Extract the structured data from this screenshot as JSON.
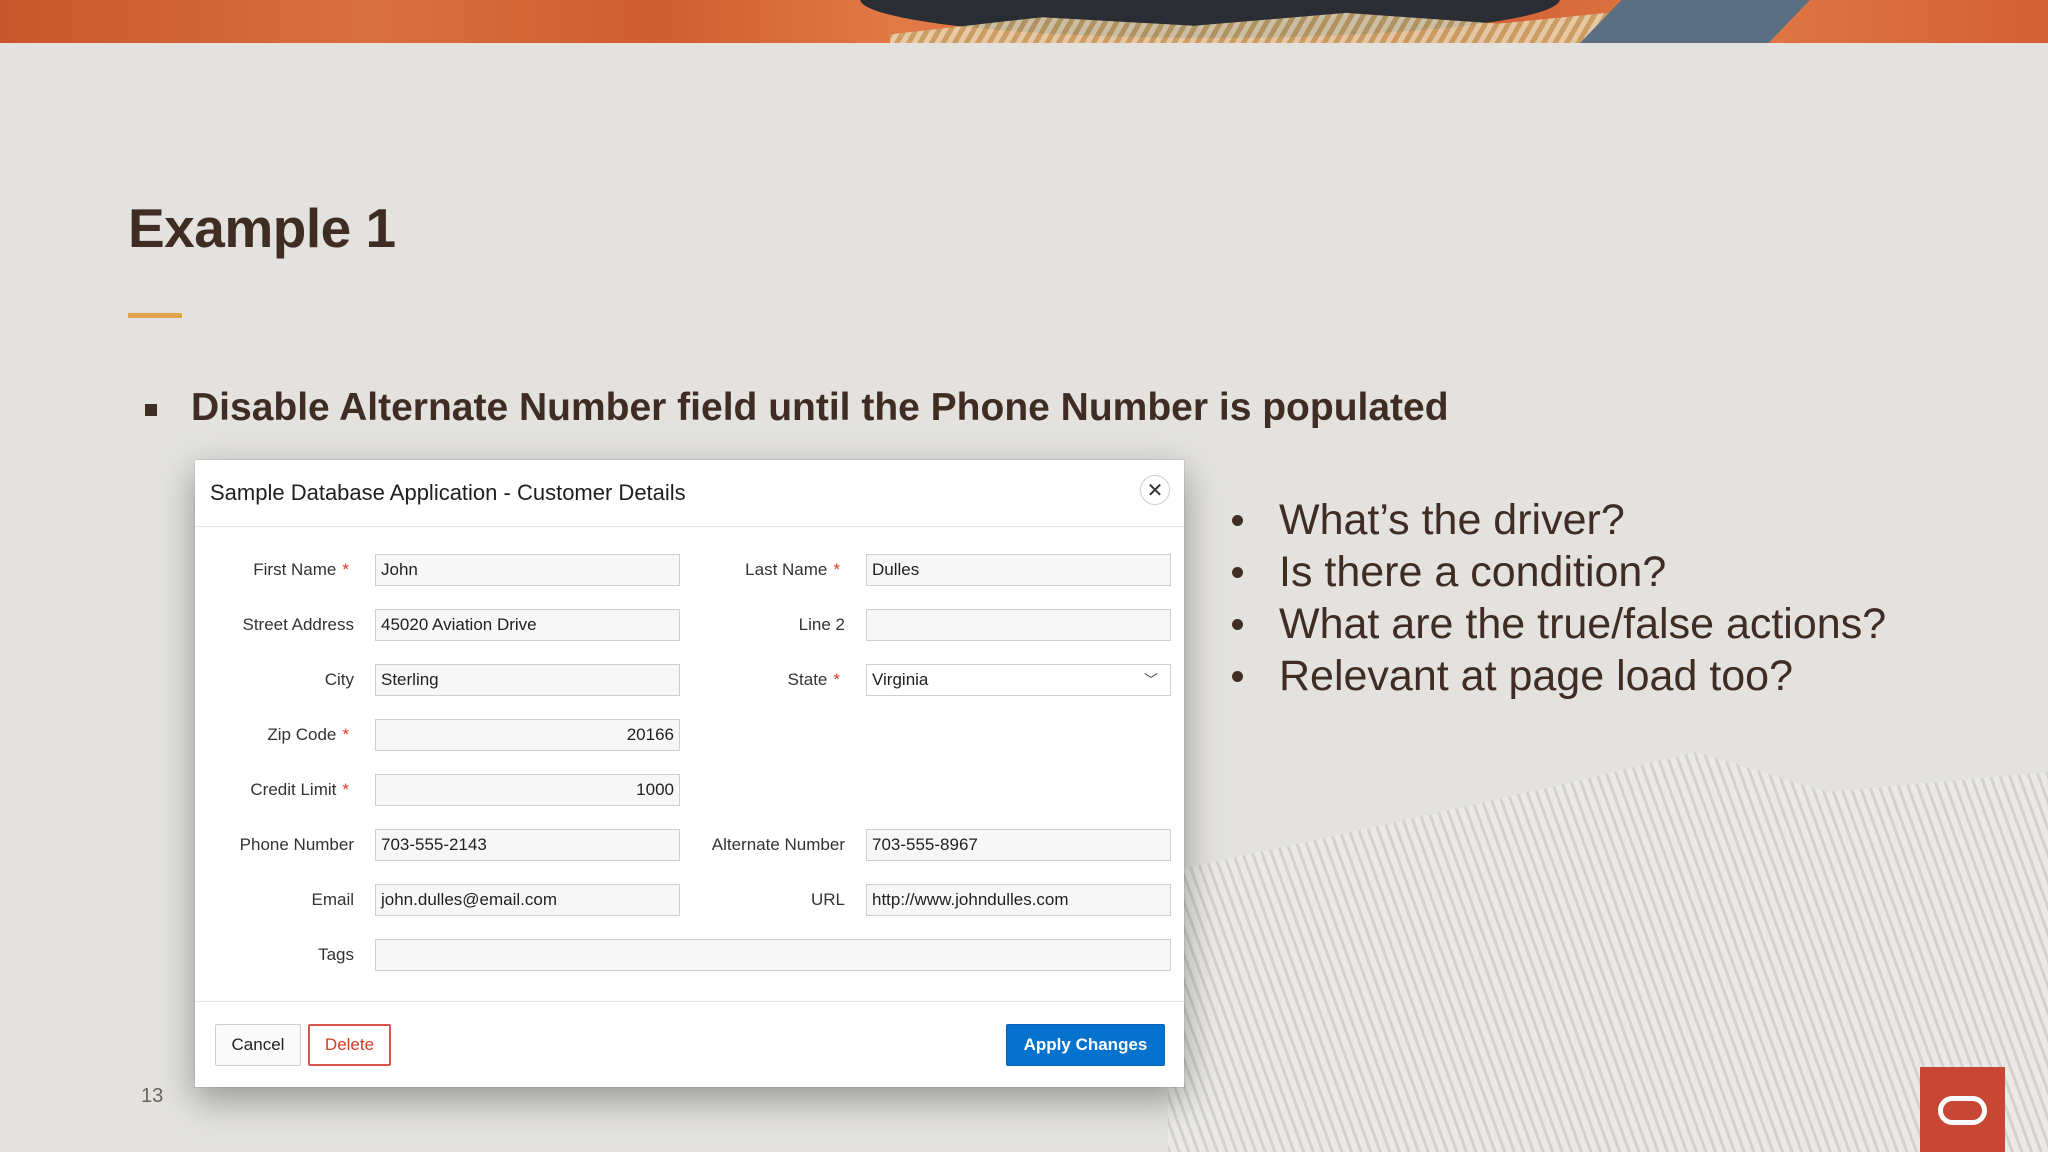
{
  "slide": {
    "title": "Example 1",
    "main_bullet": "Disable Alternate Number field until the Phone Number is populated",
    "side_bullets": [
      "What’s the driver?",
      "Is there a condition?",
      "What are the true/false actions?",
      "Relevant at page load too?"
    ],
    "page_number": "13",
    "colors": {
      "title": "#3f2d24",
      "accent_rule": "#e3a24c",
      "logo_bg": "#c74634",
      "required": "#d63b25",
      "primary_button": "#0572ce"
    }
  },
  "dialog": {
    "title": "Sample Database Application - Customer Details",
    "close_icon": "close-icon",
    "fields": {
      "first_name": {
        "label": "First Name",
        "required": "*",
        "value": "John"
      },
      "last_name": {
        "label": "Last Name",
        "required": "*",
        "value": "Dulles"
      },
      "street_address": {
        "label": "Street Address",
        "value": "45020 Aviation Drive"
      },
      "line2": {
        "label": "Line 2",
        "value": ""
      },
      "city": {
        "label": "City",
        "value": "Sterling"
      },
      "state": {
        "label": "State",
        "required": "*",
        "value": "Virginia"
      },
      "zip_code": {
        "label": "Zip Code",
        "required": "*",
        "value": "20166"
      },
      "credit_limit": {
        "label": "Credit Limit",
        "required": "*",
        "value": "1000"
      },
      "phone_number": {
        "label": "Phone Number",
        "value": "703-555-2143"
      },
      "alternate_number": {
        "label": "Alternate Number",
        "value": "703-555-8967"
      },
      "email": {
        "label": "Email",
        "value": "john.dulles@email.com"
      },
      "url": {
        "label": "URL",
        "value": "http://www.johndulles.com"
      },
      "tags": {
        "label": "Tags",
        "value": ""
      }
    },
    "buttons": {
      "cancel": "Cancel",
      "delete": "Delete",
      "apply": "Apply Changes"
    }
  }
}
